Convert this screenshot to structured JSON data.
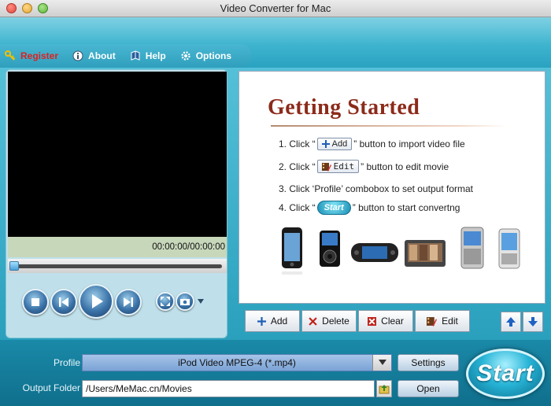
{
  "window": {
    "title": "Video Converter for Mac"
  },
  "menu": {
    "items": [
      {
        "label": "Register",
        "icon": "key-icon"
      },
      {
        "label": "About",
        "icon": "info-icon"
      },
      {
        "label": "Help",
        "icon": "book-icon"
      },
      {
        "label": "Options",
        "icon": "gear-icon"
      }
    ]
  },
  "player": {
    "time": "00:00:00/00:00:00",
    "seek_position": 0
  },
  "getting_started": {
    "title": "Getting Started",
    "steps": [
      {
        "prefix": "1. Click “",
        "button": "Add",
        "suffix": "” button to import video file"
      },
      {
        "prefix": "2. Click “",
        "button": "Edit",
        "suffix": "” button to edit movie"
      },
      {
        "text": "3. Click ‘Profile’ combobox to set output format"
      },
      {
        "prefix": "4. Click “",
        "button": "Start",
        "suffix": "” button to start convertng"
      }
    ],
    "devices": [
      "iphone-icon",
      "ipod-icon",
      "psp-icon",
      "media-player-icon",
      "smartphone-icon",
      "pda-icon"
    ]
  },
  "actions": {
    "add": "Add",
    "delete": "Delete",
    "clear": "Clear",
    "edit": "Edit"
  },
  "bottom": {
    "profile_label": "Profile",
    "profile_value": "iPod Video MPEG-4 (*.mp4)",
    "settings": "Settings",
    "output_label": "Output Folder",
    "output_value": "/Users/MeMac.cn/Movies",
    "open": "Open",
    "start": "Start"
  },
  "colors": {
    "accent": "#2aa2c0",
    "title_brown": "#8c2a1a",
    "register_red": "#dd2222"
  }
}
